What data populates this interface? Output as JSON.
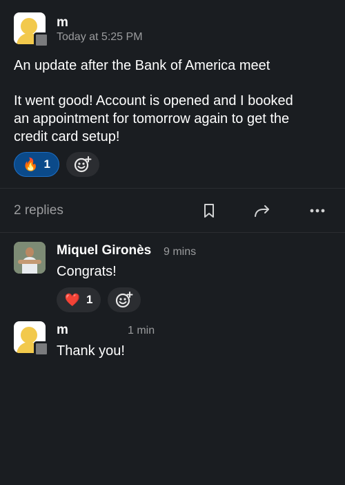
{
  "thread": {
    "author": "m",
    "timestamp": "Today at 5:25 PM",
    "message_line1": "An update after the Bank of America meet",
    "message_line2": "It went good! Account is opened and I booked",
    "message_line3": "an appointment for tomorrow again to get the",
    "message_line4": "credit card setup!",
    "reactions": [
      {
        "emoji": "🔥",
        "count": "1",
        "selected": true
      }
    ]
  },
  "actions": {
    "replies_label": "2 replies"
  },
  "replies": [
    {
      "author": "Miquel Gironès",
      "time": "9 mins",
      "text": "Congrats!",
      "reactions": [
        {
          "emoji": "❤️",
          "count": "1",
          "selected": false
        }
      ]
    },
    {
      "author": "m",
      "time": "1 min",
      "text": "Thank you!"
    }
  ],
  "colors": {
    "background": "#1a1d21",
    "selected_reaction": "#0b4a8a",
    "avatar_yellow": "#f2c94c"
  }
}
